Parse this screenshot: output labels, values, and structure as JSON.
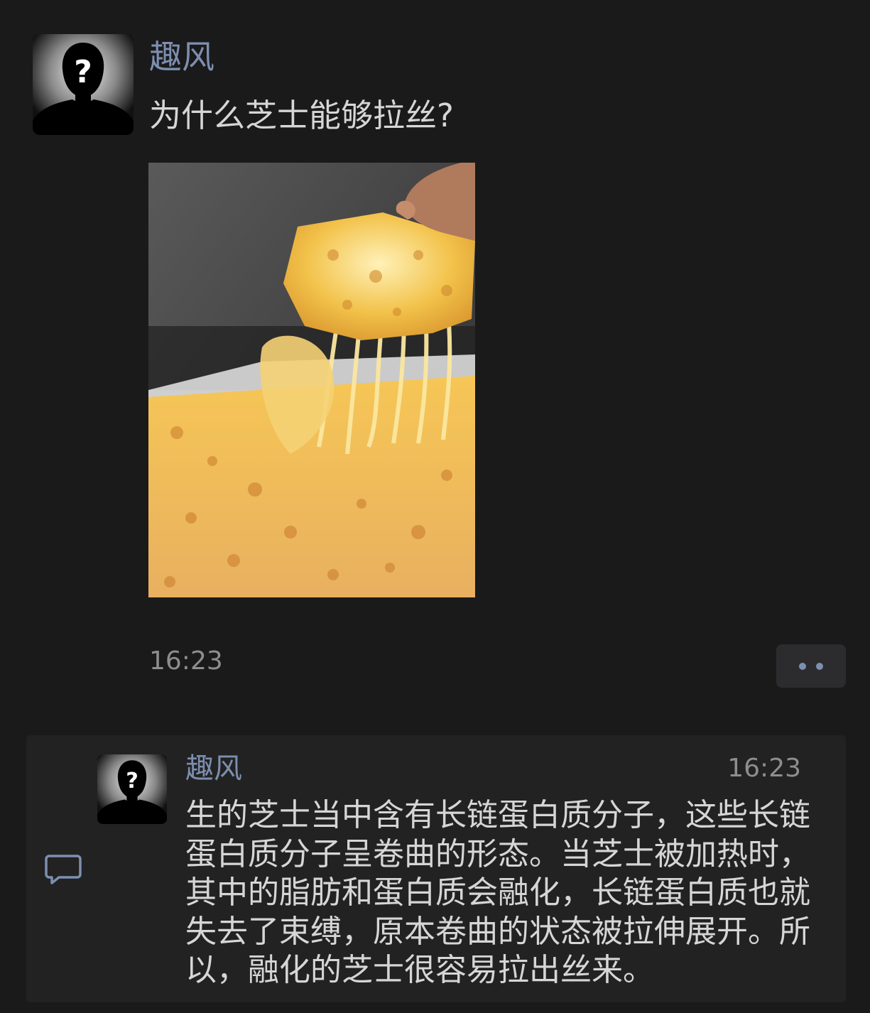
{
  "post": {
    "author": "趣风",
    "text": "为什么芝士能够拉丝?",
    "time": "16:23",
    "image_icon": "cheese-pizza-photo",
    "avatar_icon": "anonymous-silhouette-question-mark"
  },
  "more_button": {
    "icon": "more-dots-icon"
  },
  "comments": [
    {
      "author": "趣风",
      "time": "16:23",
      "text": "生的芝士当中含有长链蛋白质分子，这些长链蛋白质分子呈卷曲的形态。当芝士被加热时，其中的脂肪和蛋白质会融化，长链蛋白质也就失去了束缚，原本卷曲的状态被拉伸展开。所以，融化的芝士很容易拉出丝来。",
      "avatar_icon": "anonymous-silhouette-question-mark"
    }
  ],
  "comment_icon": "comment-bubble-icon",
  "colors": {
    "background": "#1a1a1a",
    "name": "#7d8fb0",
    "text": "#d6d6d6",
    "time": "#8e8e8e",
    "panel": "#222222"
  }
}
